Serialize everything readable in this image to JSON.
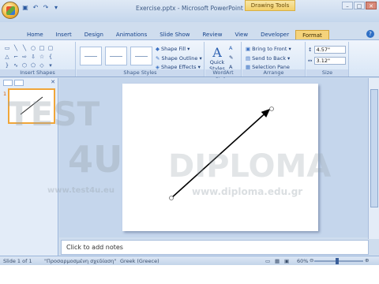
{
  "window": {
    "title": "Exercise.pptx - Microsoft PowerPoint",
    "context_tab": "Drawing Tools"
  },
  "tabs": [
    "Home",
    "Insert",
    "Design",
    "Animations",
    "Slide Show",
    "Review",
    "View",
    "Developer",
    "Format"
  ],
  "ribbon": {
    "groups": {
      "insert_shapes": "Insert Shapes",
      "shape_styles": "Shape Styles",
      "wordart_styles": "WordArt Styles",
      "arrange": "Arrange",
      "size": "Size"
    },
    "shape_fill": "Shape Fill",
    "shape_outline": "Shape Outline",
    "shape_effects": "Shape Effects",
    "quick_styles": "Quick Styles",
    "bring_to_front": "Bring to Front",
    "send_to_back": "Send to Back",
    "selection_pane": "Selection Pane",
    "height": "4.57\"",
    "width": "3.12\""
  },
  "slide_panel": {
    "slide_number": "1"
  },
  "notes_placeholder": "Click to add notes",
  "status": {
    "slide_info": "Slide 1 of 1",
    "theme": "\"Προσαρμοσμένη σχεδίαση\"",
    "language": "Greek (Greece)",
    "zoom": "60%"
  },
  "watermark": {
    "test": "TEST",
    "four_u": "4U",
    "url1": "www.test4u.eu",
    "diploma": "DIPLOMA",
    "url2": "www.diploma.edu.gr"
  },
  "colors": {
    "accent_tab": "#f5d37b",
    "selection_border": "#f0a63a"
  }
}
